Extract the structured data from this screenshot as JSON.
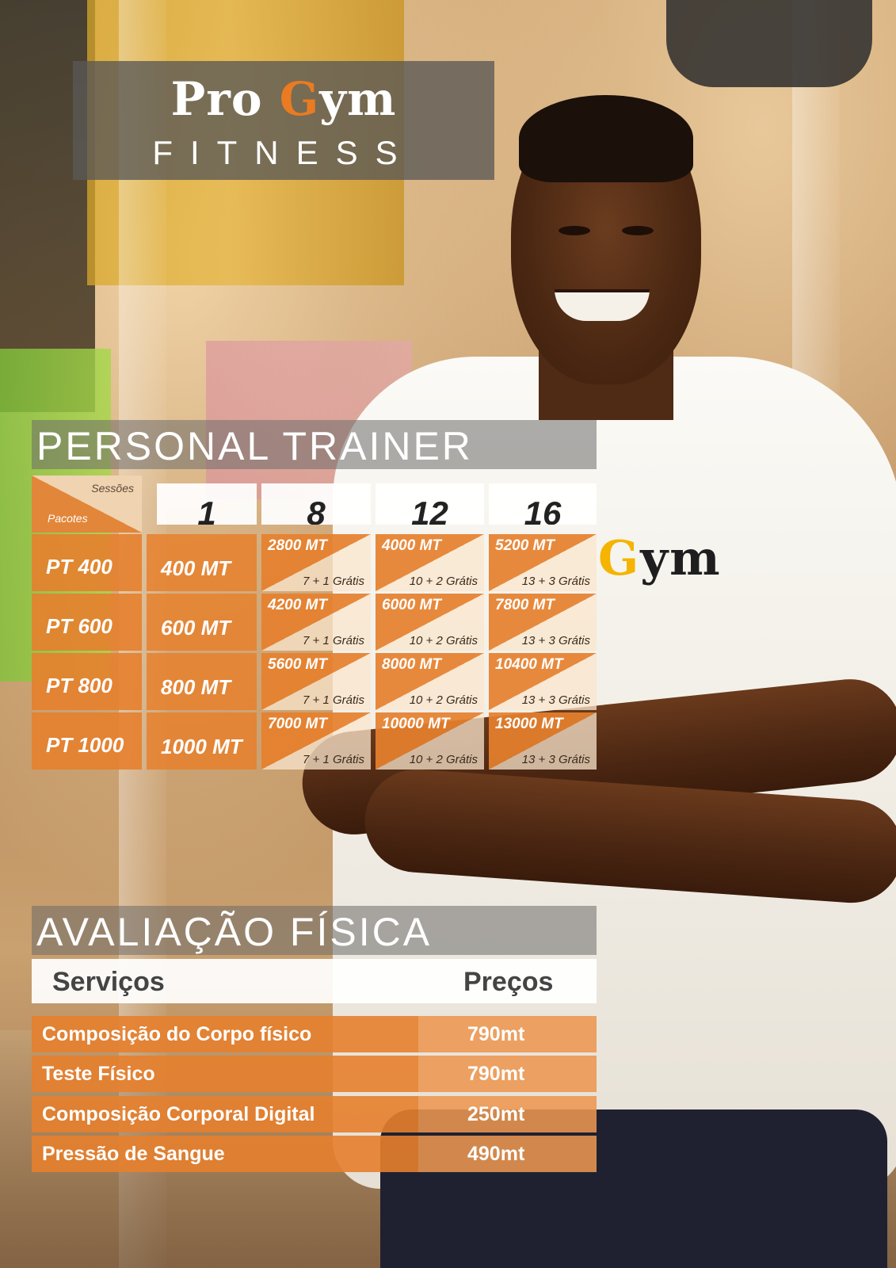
{
  "logo": {
    "word_pro": "Pro",
    "letter_g": "G",
    "word_ym": "ym",
    "subtitle": "FITNESS"
  },
  "shirt_logo": {
    "letter_g": "G",
    "word_ym": "ym"
  },
  "personal_trainer": {
    "title": "PERSONAL TRAINER",
    "corner_top": "Sessões",
    "corner_bottom": "Pacotes",
    "sessions": [
      "1",
      "8",
      "12",
      "16"
    ],
    "packages": [
      {
        "name": "PT 400",
        "single": "400 MT",
        "deals": [
          {
            "price": "2800 MT",
            "bonus": "7 + 1 Grátis"
          },
          {
            "price": "4000 MT",
            "bonus": "10 + 2 Grátis"
          },
          {
            "price": "5200 MT",
            "bonus": "13 + 3 Grátis"
          }
        ]
      },
      {
        "name": "PT 600",
        "single": "600 MT",
        "deals": [
          {
            "price": "4200 MT",
            "bonus": "7 + 1 Grátis"
          },
          {
            "price": "6000 MT",
            "bonus": "10 + 2 Grátis"
          },
          {
            "price": "7800 MT",
            "bonus": "13 + 3 Grátis"
          }
        ]
      },
      {
        "name": "PT 800",
        "single": "800 MT",
        "deals": [
          {
            "price": "5600 MT",
            "bonus": "7 + 1 Grátis"
          },
          {
            "price": "8000 MT",
            "bonus": "10 + 2 Grátis"
          },
          {
            "price": "10400 MT",
            "bonus": "13 + 3 Grátis"
          }
        ]
      },
      {
        "name": "PT 1000",
        "single": "1000 MT",
        "deals": [
          {
            "price": "7000 MT",
            "bonus": "7 + 1 Grátis"
          },
          {
            "price": "10000 MT",
            "bonus": "10 + 2 Grátis"
          },
          {
            "price": "13000 MT",
            "bonus": "13 + 3 Grátis"
          }
        ]
      }
    ]
  },
  "avaliacao": {
    "title": "AVALIAÇÃO FÍSICA",
    "header_services": "Serviços",
    "header_prices": "Preços",
    "rows": [
      {
        "service": "Composição do Corpo físico",
        "price": "790mt"
      },
      {
        "service": "Teste Físico",
        "price": "790mt"
      },
      {
        "service": "Composição Corporal Digital",
        "price": "250mt"
      },
      {
        "service": "Pressão de Sangue",
        "price": "490mt"
      }
    ]
  },
  "colors": {
    "accent_orange": "#e6802d",
    "logo_orange": "#ea7b22",
    "shirt_yellow": "#f4b400"
  }
}
